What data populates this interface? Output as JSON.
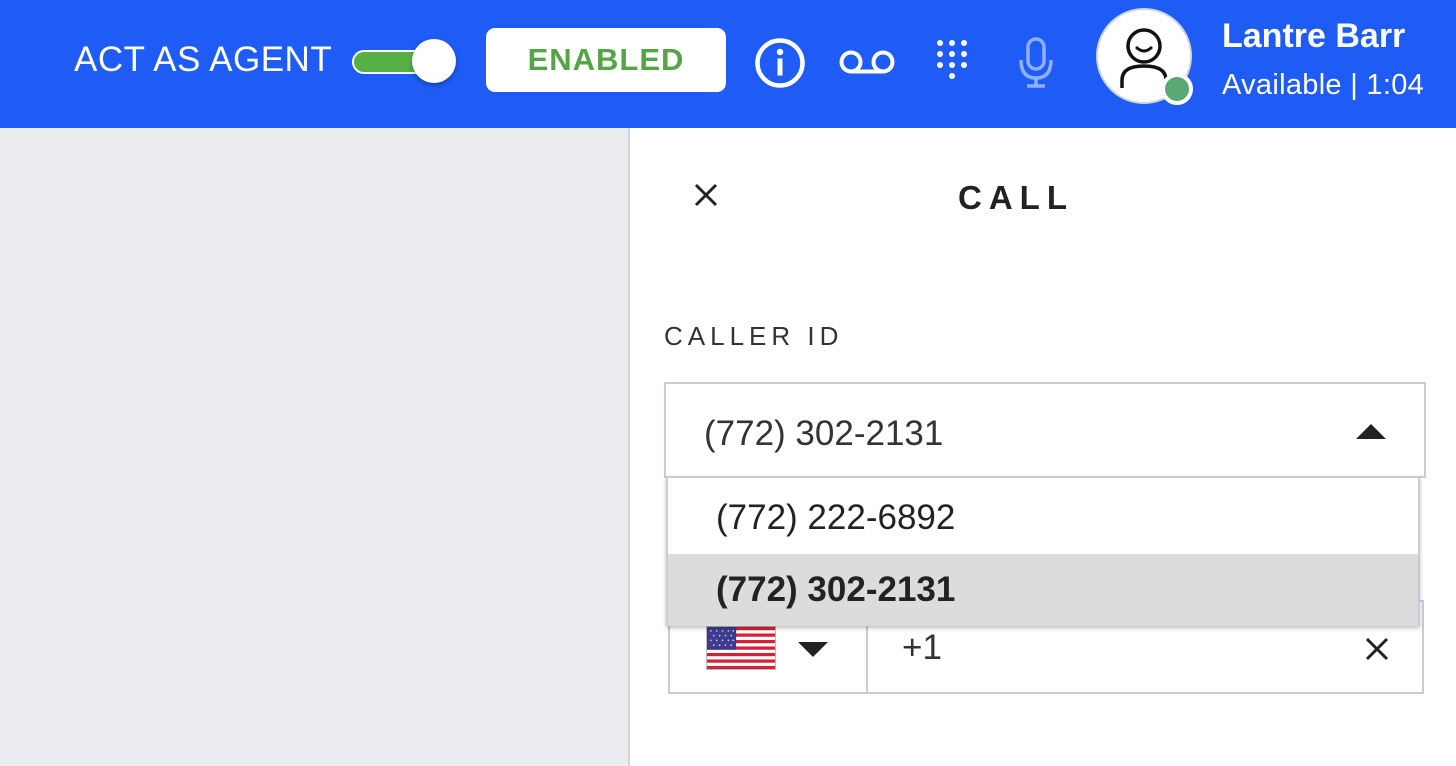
{
  "header": {
    "act_as_agent_label": "ACT AS AGENT",
    "act_as_agent_toggle_on": true,
    "enabled_button_label": "ENABLED",
    "icons": [
      "info-icon",
      "voicemail-icon",
      "dialpad-icon",
      "microphone-icon"
    ],
    "user": {
      "name": "Lantre Barr",
      "status": "Available | 1:04",
      "presence_color": "#5aa873"
    },
    "colors": {
      "bar": "#1e5cf5",
      "toggle_on": "#56b045",
      "enabled_text": "#55a547"
    }
  },
  "call_panel": {
    "title": "CALL",
    "caller_id_label": "CALLER ID",
    "caller_id_selected": "(772) 302-2131",
    "caller_id_options": [
      "(772) 222-6892",
      "(772) 302-2131"
    ],
    "country_code": "+1",
    "country_flag": "us-flag-icon"
  }
}
